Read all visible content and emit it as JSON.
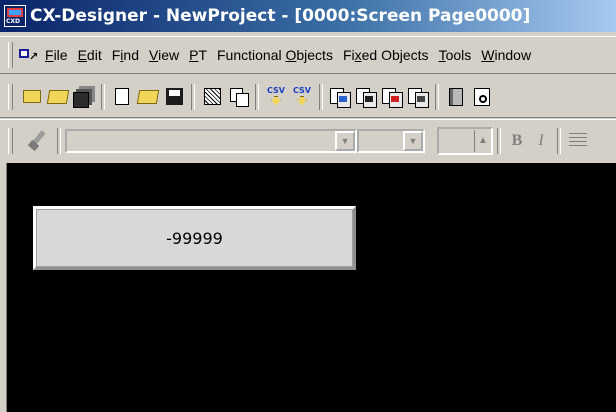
{
  "window": {
    "title": "CX-Designer - NewProject - [0000:Screen Page0000]",
    "app_icon_label": "CXD"
  },
  "menubar": {
    "items": [
      {
        "label": "File",
        "accel": "F"
      },
      {
        "label": "Edit",
        "accel": "E"
      },
      {
        "label": "Find",
        "accel": "i"
      },
      {
        "label": "View",
        "accel": "V"
      },
      {
        "label": "PT",
        "accel": "P"
      },
      {
        "label": "Functional Objects",
        "accel": "O"
      },
      {
        "label": "Fixed Objects",
        "accel": "x"
      },
      {
        "label": "Tools",
        "accel": "T"
      },
      {
        "label": "Window",
        "accel": "W"
      }
    ]
  },
  "toolbar": {
    "csv_label": "CSV",
    "icons": [
      "new-project-icon",
      "open-project-icon",
      "save-all-icon",
      "new-screen-icon",
      "open-icon",
      "save-icon",
      "hatch-icon",
      "copy-icon",
      "csv-import-icon",
      "csv-export-icon",
      "object-icon-1",
      "object-icon-2",
      "object-icon-3",
      "object-icon-4",
      "book-icon",
      "print-preview-icon"
    ]
  },
  "format_toolbar": {
    "font_name": "",
    "font_size": "",
    "line_width": "",
    "bold_label": "B",
    "italic_label": "I"
  },
  "canvas": {
    "background": "#000000",
    "numeric_display": {
      "value": "-99999"
    }
  },
  "colors": {
    "title_start": "#0a246a",
    "title_end": "#a6caf0",
    "chrome": "#d4d0c8"
  }
}
